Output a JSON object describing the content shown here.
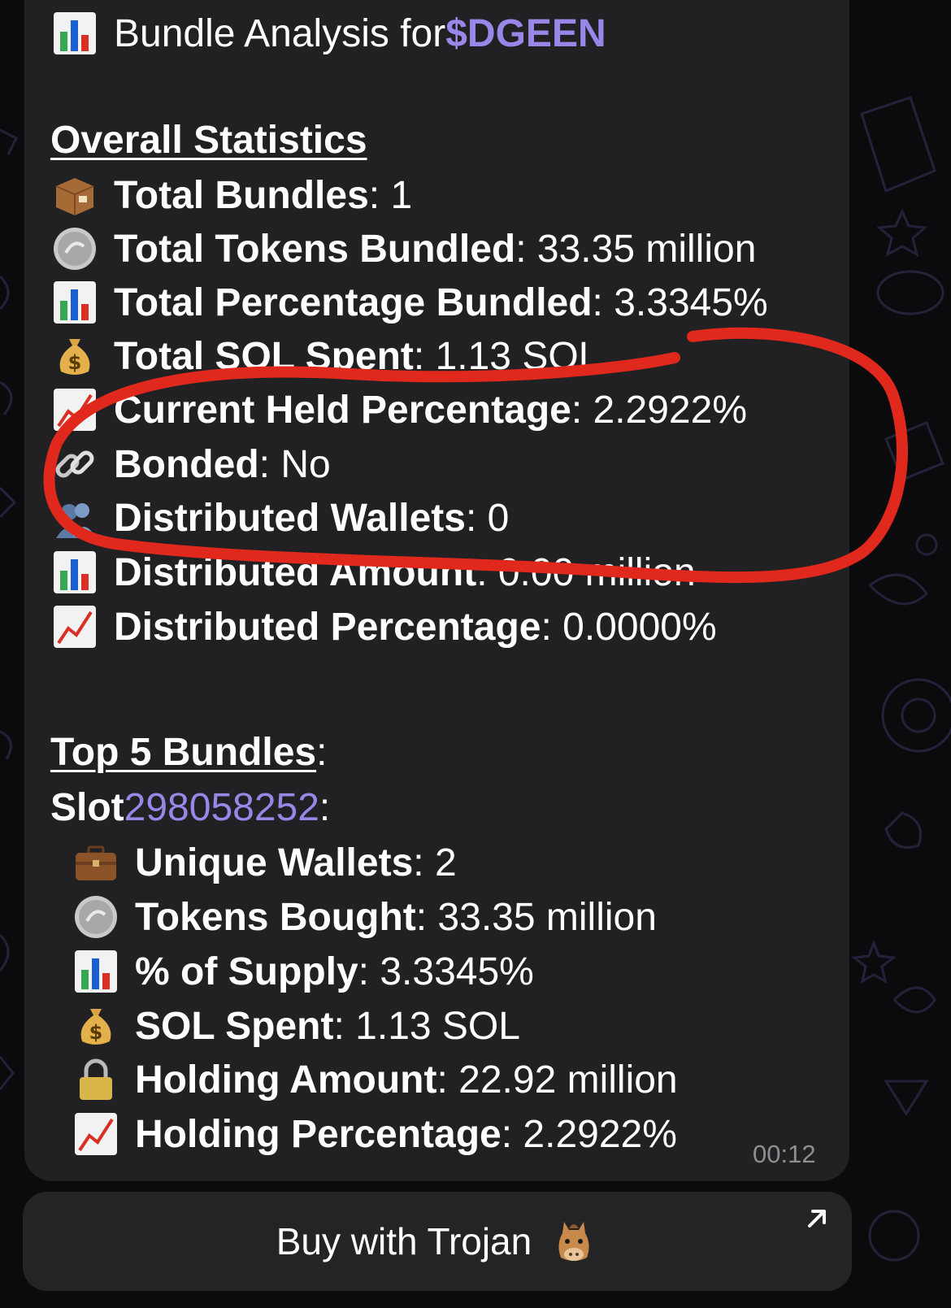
{
  "header": {
    "title_prefix": "Bundle Analysis for ",
    "ticker": "$DGEEN",
    "title_icon": "bar-chart-icon"
  },
  "overall": {
    "heading": "Overall Statistics",
    "rows": [
      {
        "icon": "package-icon",
        "label": "Total Bundles",
        "value": "1"
      },
      {
        "icon": "coin-icon",
        "label": "Total Tokens Bundled",
        "value": "33.35 million"
      },
      {
        "icon": "bar-chart-icon",
        "label": "Total Percentage Bundled",
        "value": "3.3345%"
      },
      {
        "icon": "money-bag-icon",
        "label": "Total SOL Spent",
        "value": "1.13 SOL"
      },
      {
        "icon": "chart-up-icon",
        "label": "Current Held Percentage",
        "value": "2.2922%"
      },
      {
        "icon": "link-icon",
        "label": "Bonded",
        "value": "No"
      },
      {
        "icon": "people-icon",
        "label": "Distributed Wallets",
        "value": "0"
      },
      {
        "icon": "bar-chart-icon",
        "label": "Distributed Amount",
        "value": "0.00 million"
      },
      {
        "icon": "chart-up-icon",
        "label": "Distributed Percentage",
        "value": "0.0000%"
      }
    ]
  },
  "top": {
    "heading": "Top 5 Bundles",
    "slot_label": "Slot ",
    "slot_number": "298058252",
    "rows": [
      {
        "icon": "briefcase-icon",
        "label": "Unique Wallets",
        "value": "2"
      },
      {
        "icon": "coin-icon",
        "label": "Tokens Bought",
        "value": "33.35 million"
      },
      {
        "icon": "bar-chart-icon",
        "label": "% of Supply",
        "value": "3.3345%"
      },
      {
        "icon": "money-bag-icon",
        "label": "SOL Spent",
        "value": "1.13 SOL"
      },
      {
        "icon": "lock-icon",
        "label": "Holding Amount",
        "value": "22.92 million"
      },
      {
        "icon": "chart-up-icon",
        "label": "Holding Percentage",
        "value": "2.2922%"
      }
    ]
  },
  "message": {
    "timestamp": "00:12"
  },
  "button": {
    "label": "Buy with Trojan",
    "icon": "horse-icon",
    "corner_icon": "external-arrow-icon"
  },
  "colors": {
    "bubble": "#212124",
    "background": "#0b0b0d",
    "accent": "#9a86e8",
    "annotation": "#e0281c",
    "timestamp": "#8e8e93"
  }
}
